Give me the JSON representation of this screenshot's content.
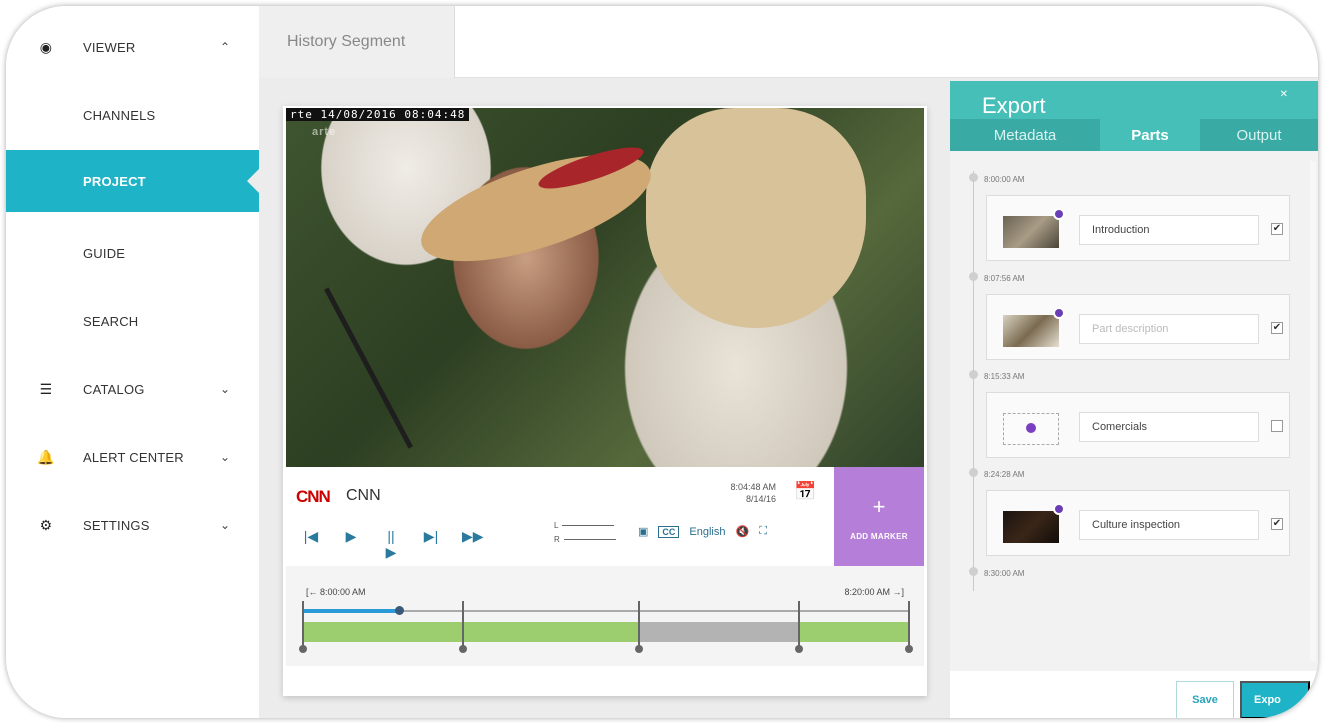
{
  "sidebar": {
    "items": [
      {
        "label": "VIEWER",
        "chevron": "^"
      },
      {
        "label": "CHANNELS"
      },
      {
        "label": "PROJECT"
      },
      {
        "label": "GUIDE"
      },
      {
        "label": "SEARCH"
      },
      {
        "label": "CATALOG",
        "chevron": "v"
      },
      {
        "label": "ALERT CENTER",
        "chevron": "v"
      },
      {
        "label": "SETTINGS",
        "chevron": "v"
      }
    ],
    "accent_color": "#1eb3c6"
  },
  "topbar": {
    "tab_label": "History Segment"
  },
  "player": {
    "overlay_timestamp": "rte 14/08/2016 08:04:48",
    "overlay_logo": "arte",
    "channel_logo": "CNN",
    "channel_name": "CNN",
    "time": "8:04:48 AM",
    "date": "8/14/16",
    "lr_left": "L",
    "lr_right": "R",
    "cc": "CC",
    "language": "English",
    "add_marker_label": "ADD MARKER",
    "add_marker_color": "#b57ed8"
  },
  "timeline": {
    "start": "8:00:00 AM",
    "end": "8:20:00 AM",
    "progress": 0.16
  },
  "export": {
    "title": "Export",
    "tabs": [
      "Metadata",
      "Parts",
      "Output"
    ],
    "active_tab": "Parts",
    "times": [
      "8:00:00 AM",
      "8:07:56 AM",
      "8:15:33 AM",
      "8:24:28 AM",
      "8:30:00 AM"
    ],
    "parts": [
      {
        "value": "Introduction",
        "placeholder": "Part description",
        "checked": "✔"
      },
      {
        "value": "",
        "placeholder": "Part description",
        "checked": "✔"
      },
      {
        "value": "Comercials",
        "placeholder": "Part description",
        "checked": ""
      },
      {
        "value": "Culture inspection",
        "placeholder": "Part description",
        "checked": "✔"
      }
    ],
    "save_label": "Save",
    "export_label": "Expo"
  }
}
